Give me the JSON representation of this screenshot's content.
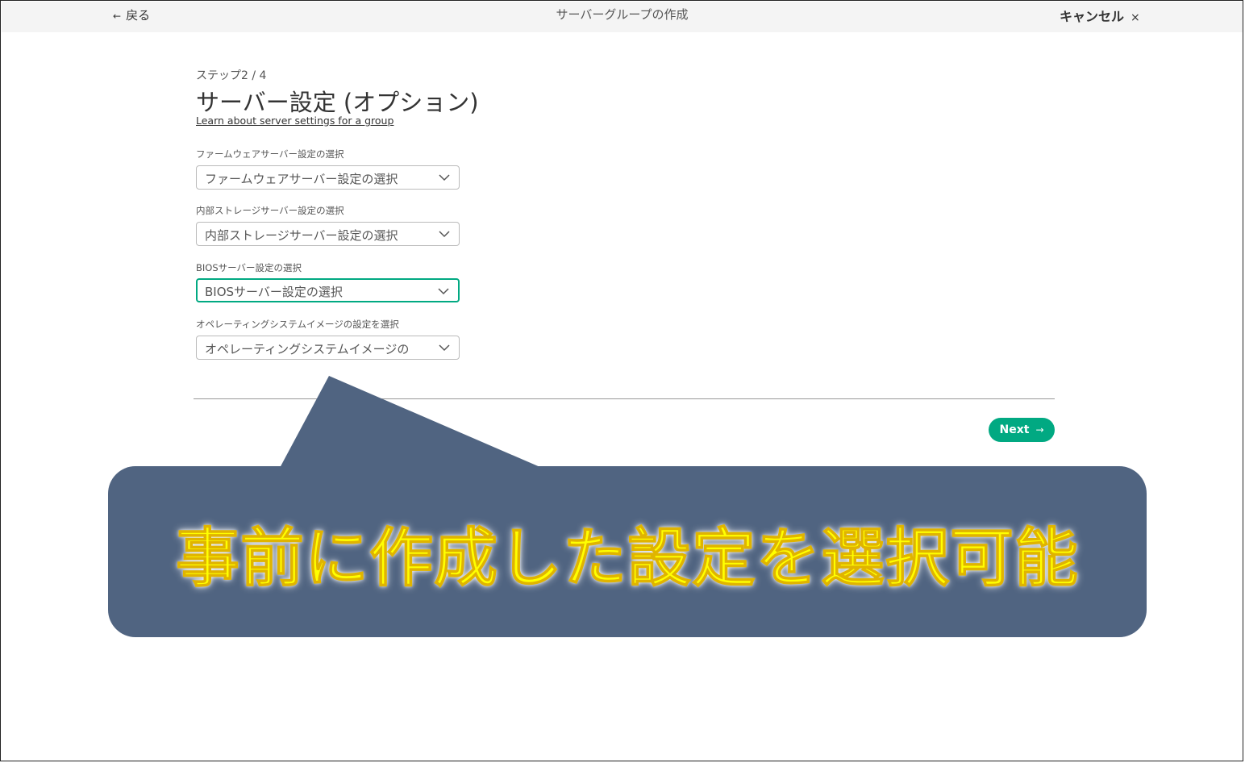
{
  "header": {
    "back_label": "戻る",
    "title": "サーバーグループの作成",
    "cancel_label": "キャンセル",
    "close_symbol": "×"
  },
  "content": {
    "step": "ステップ2 / 4",
    "heading": "サーバー設定 (オプション)",
    "learn_link": "Learn about server settings for a group",
    "fields": [
      {
        "label": "ファームウェアサーバー設定の選択",
        "value": "ファームウェアサーバー設定の選択"
      },
      {
        "label": "内部ストレージサーバー設定の選択",
        "value": "内部ストレージサーバー設定の選択"
      },
      {
        "label": "BIOSサーバー設定の選択",
        "value": "BIOSサーバー設定の選択"
      },
      {
        "label": "オペレーティングシステムイメージの設定を選択",
        "value": "オペレーティングシステムイメージの"
      }
    ],
    "next_label": "Next"
  },
  "callout": {
    "text": "事前に作成した設定を選択可能"
  },
  "colors": {
    "accent": "#01a982",
    "callout_bg": "#506481",
    "callout_text": "#ffff00",
    "topbar_bg": "#f4f4f4"
  },
  "icons": {
    "back": "arrow-left-icon",
    "close": "close-icon",
    "chevron": "chevron-down-icon",
    "next": "arrow-right-icon"
  }
}
